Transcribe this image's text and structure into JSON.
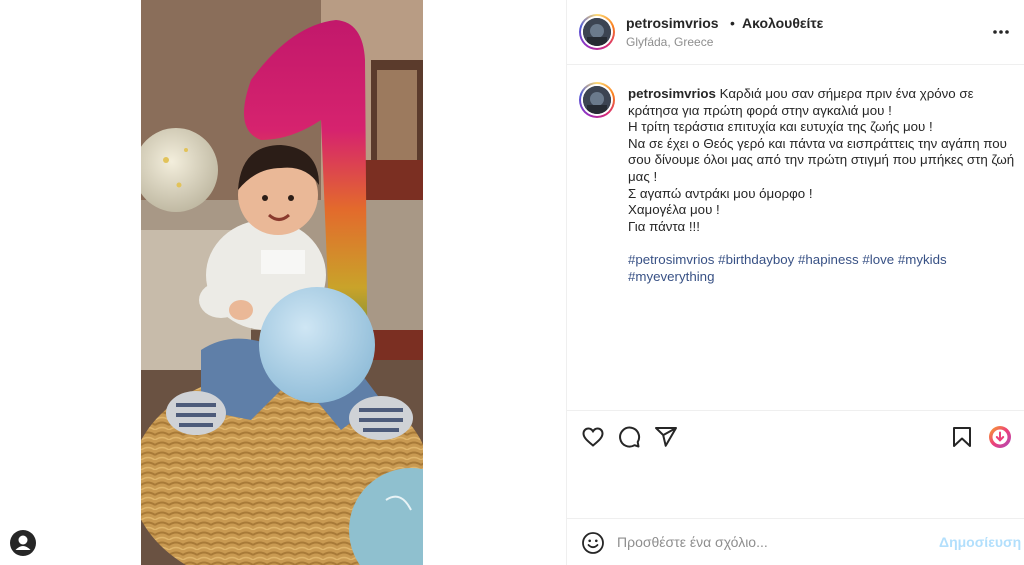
{
  "post": {
    "username": "petrosimvrios",
    "separator": "•",
    "follow_status": "Ακολουθείτε",
    "location": "Glyfáda, Greece"
  },
  "caption": {
    "username": "petrosimvrios",
    "lines": [
      "Καρδιά μου σαν σήμερα πριν ένα χρόνο σε",
      "κράτησα για πρώτη φορά στην αγκαλιά μου !",
      "Η τρίτη τεράστια επιτυχία και ευτυχία της ζωής μου !",
      "Να σε έχει ο Θεός γερό και πάντα να εισπράττεις την αγάπη που",
      "σου δίνουμε όλοι μας από την πρώτη στιγμή που μπήκες στη ζωή",
      "μας !",
      "Σ αγαπώ αντράκι μου όμορφο !",
      "Χαμογέλα μου !",
      "Για πάντα !!!"
    ],
    "hashtags": [
      "#petrosimvrios",
      "#birthdayboy",
      "#hapiness",
      "#love",
      "#mykids",
      "#myeverything"
    ]
  },
  "comment": {
    "placeholder": "Προσθέστε ένα σχόλιο...",
    "post_label": "Δημοσίευση"
  },
  "icons": {
    "more": "more-options-icon",
    "like": "heart-icon",
    "comment": "comment-icon",
    "share": "send-icon",
    "save": "bookmark-icon",
    "download": "download-icon",
    "emoji": "emoji-icon",
    "profile": "user-icon"
  },
  "colors": {
    "link": "#385185",
    "muted": "#8e8e8e",
    "post_button": "#b2dffc",
    "text": "#262626"
  }
}
